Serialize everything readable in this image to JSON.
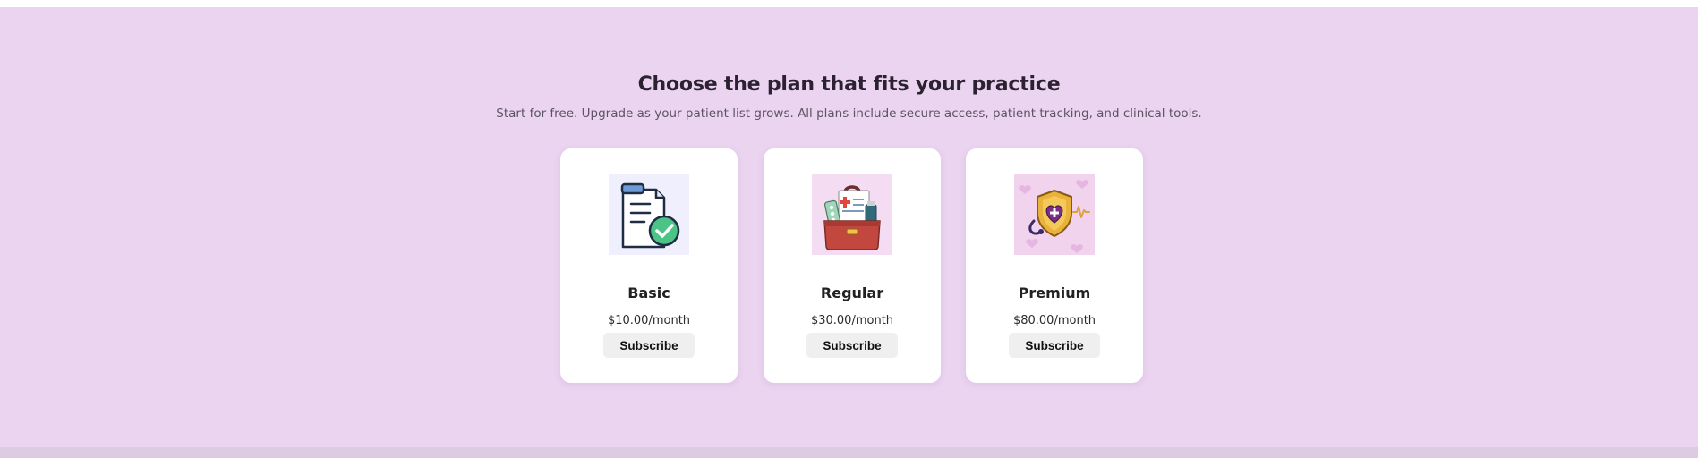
{
  "pricing": {
    "heading": "Choose the plan that fits your practice",
    "subheading": "Start for free. Upgrade as your patient list grows. All plans include secure access, patient tracking, and clinical tools.",
    "plans": [
      {
        "name": "Basic",
        "price": "$10.00/month",
        "button_label": "Subscribe",
        "icon": "clipboard-check-icon",
        "image_bg": "#f0effd"
      },
      {
        "name": "Regular",
        "price": "$30.00/month",
        "button_label": "Subscribe",
        "icon": "medical-bag-icon",
        "image_bg": "#f4ddf2"
      },
      {
        "name": "Premium",
        "price": "$80.00/month",
        "button_label": "Subscribe",
        "icon": "shield-heart-stethoscope-icon",
        "image_bg": "#f1d3ee"
      }
    ]
  },
  "colors": {
    "section_bg": "#ead4f0",
    "footer_bg": "#dccbe2",
    "card_bg": "#ffffff",
    "button_bg": "#efefef"
  }
}
